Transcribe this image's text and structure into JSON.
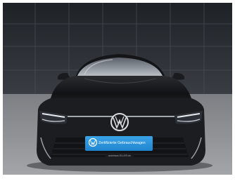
{
  "photo": {
    "plate_text": "Zertifizierte Gebrauchtwagen",
    "plate_subtext": "autohaus ELLER.de",
    "colors": {
      "background_panels": "#2b2e33",
      "floor": "#8d8f92",
      "car_body": "#1c1d20",
      "plate": "#2f97df"
    }
  }
}
